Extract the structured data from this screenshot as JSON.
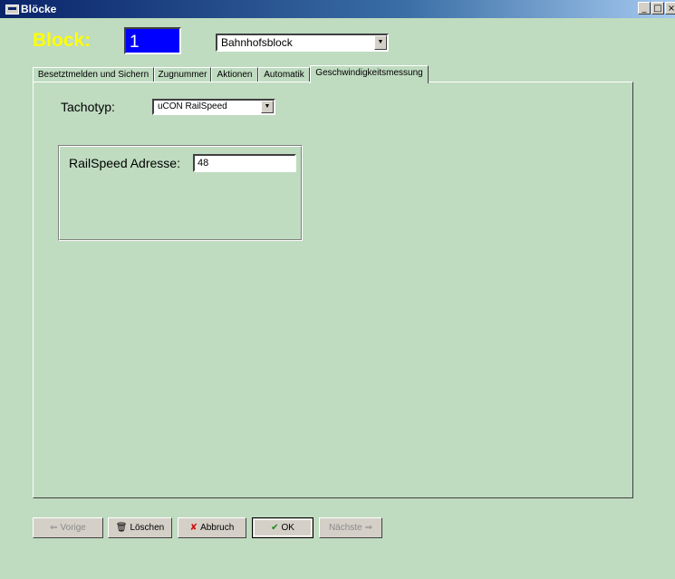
{
  "window": {
    "title": "Blöcke",
    "buttons": [
      "_",
      "□",
      "×"
    ]
  },
  "header": {
    "block_label": "Block:",
    "block_number": "1",
    "block_select": "Bahnhofsblock"
  },
  "tabs": [
    {
      "label": "Besetztmelden und Sichern",
      "active": false
    },
    {
      "label": "Zugnummer",
      "active": false
    },
    {
      "label": "Aktionen",
      "active": false
    },
    {
      "label": "Automatik",
      "active": false
    },
    {
      "label": "Geschwindigkeitsmessung",
      "active": true
    }
  ],
  "panel": {
    "tachotyp_label": "Tachotyp:",
    "tachotyp_value": "uCON RailSpeed",
    "railspeed_label": "RailSpeed Adresse:",
    "railspeed_value": "48"
  },
  "buttons": {
    "prev": "Vorige",
    "delete": "Löschen",
    "cancel": "Abbruch",
    "ok": "OK",
    "next": "Nächste"
  },
  "colors": {
    "background": "#bfdbc0",
    "block_label": "#ffff00",
    "block_number_bg": "#0000ff"
  }
}
